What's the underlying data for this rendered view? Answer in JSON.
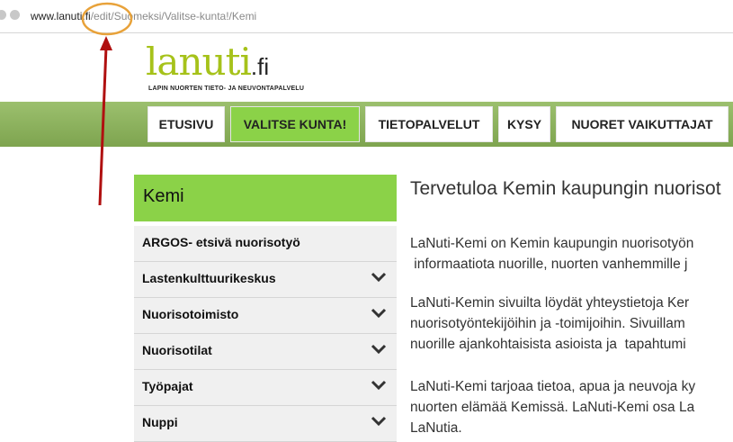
{
  "browser": {
    "url_domain": "www.lanuti.fi",
    "url_path": "/edit/Suomeksi/Valitse-kunta!/Kemi"
  },
  "logo": {
    "wordmark": "lanuti",
    "tld": ".fi",
    "tagline": "LAPIN NUORTEN TIETO- JA NEUVONTAPALVELU"
  },
  "nav": {
    "items": [
      "ETUSIVU",
      "VALITSE KUNTA!",
      "TIETOPALVELUT",
      "KYSY",
      "NUORET VAIKUTTAJAT"
    ],
    "active_index": 1
  },
  "sidebar": {
    "title": "Kemi",
    "items": [
      {
        "label": "ARGOS- etsivä nuorisotyö",
        "has_submenu": false
      },
      {
        "label": "Lastenkulttuurikeskus",
        "has_submenu": true
      },
      {
        "label": "Nuorisotoimisto",
        "has_submenu": true
      },
      {
        "label": "Nuorisotilat",
        "has_submenu": true
      },
      {
        "label": "Työpajat",
        "has_submenu": true
      },
      {
        "label": "Nuppi",
        "has_submenu": true
      }
    ]
  },
  "content": {
    "title": "Tervetuloa Kemin kaupungin nuorisot",
    "paragraphs": [
      [
        "LaNuti-Kemi on Kemin kaupungin nuorisotyön",
        " informaatiota nuorille, nuorten vanhemmille j"
      ],
      [
        "LaNuti-Kemin sivuilta löydät yhteystietoja Ker",
        "nuorisotyöntekijöihin ja -toimijoihin. Sivuillam",
        "nuorille ajankohtaisista asioista ja  tapahtumi"
      ],
      [
        "LaNuti-Kemi tarjoaa tietoa, apua ja neuvoja ky",
        "nuorten elämää Kemissä. LaNuti-Kemi osa La",
        "LaNutia."
      ]
    ]
  },
  "colors": {
    "accent_green": "#8bd248",
    "nav_band": "#86ad5a",
    "logo_green": "#a6c21a",
    "annotation_red": "#b01010",
    "annotation_orange": "#e8a23a"
  }
}
